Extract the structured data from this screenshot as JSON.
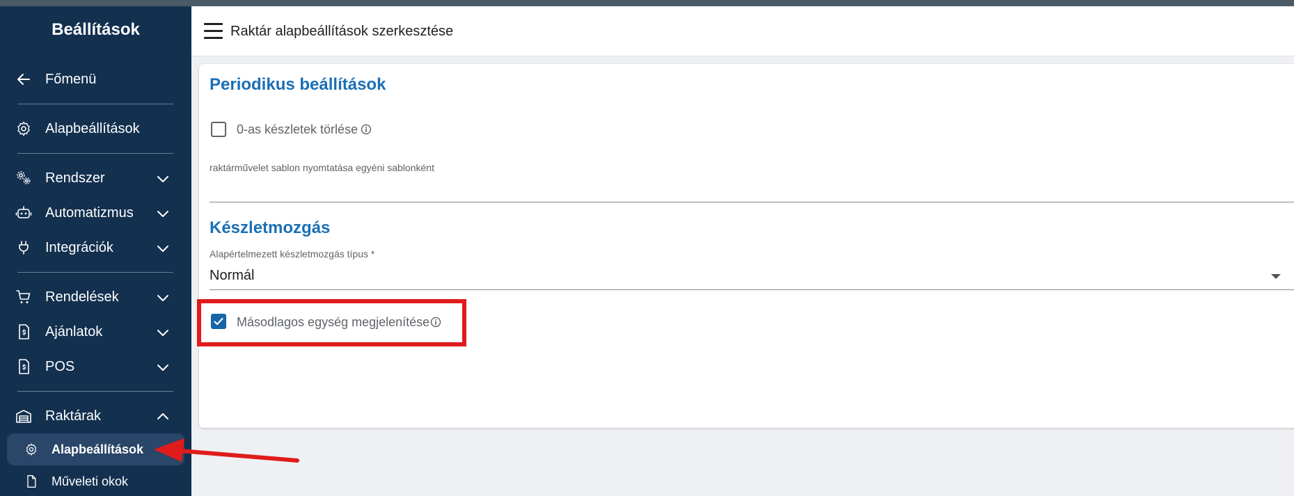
{
  "sidebar": {
    "title": "Beállítások",
    "items": [
      {
        "label": "Főmenü",
        "icon": "arrow-left-icon"
      },
      {
        "label": "Alapbeállítások",
        "icon": "gear-icon"
      },
      {
        "label": "Rendszer",
        "icon": "gears-icon"
      },
      {
        "label": "Automatizmus",
        "icon": "robot-icon"
      },
      {
        "label": "Integrációk",
        "icon": "plug-icon"
      },
      {
        "label": "Rendelések",
        "icon": "cart-icon"
      },
      {
        "label": "Ajánlatok",
        "icon": "invoice-icon"
      },
      {
        "label": "POS",
        "icon": "invoice-icon"
      },
      {
        "label": "Raktárak",
        "icon": "warehouse-icon"
      }
    ],
    "sub_items": [
      {
        "label": "Alapbeállítások",
        "icon": "gear-icon",
        "active": true
      },
      {
        "label": "Műveleti okok",
        "icon": "document-icon",
        "active": false
      }
    ]
  },
  "header": {
    "title": "Raktár alapbeállítások szerkesztése"
  },
  "periodic": {
    "title": "Periodikus beállítások",
    "delete_zero_stock_label": "0-as készletek törlése",
    "delete_zero_stock_checked": false,
    "template_print_label": "raktárművelet sablon nyomtatása egyéni sablonként",
    "template_print_value": ""
  },
  "stock_movement": {
    "title": "Készletmozgás",
    "type_label": "Alapértelmezett készletmozgás típus *",
    "type_value": "Normál",
    "secondary_unit_label": "Másodlagos egység megjelenítése",
    "secondary_unit_checked": true
  },
  "colors": {
    "sidebar_bg": "#13304f",
    "accent_blue": "#1a6fb5",
    "checkbox_blue": "#1565a8",
    "highlight_red": "#e01b1b"
  }
}
